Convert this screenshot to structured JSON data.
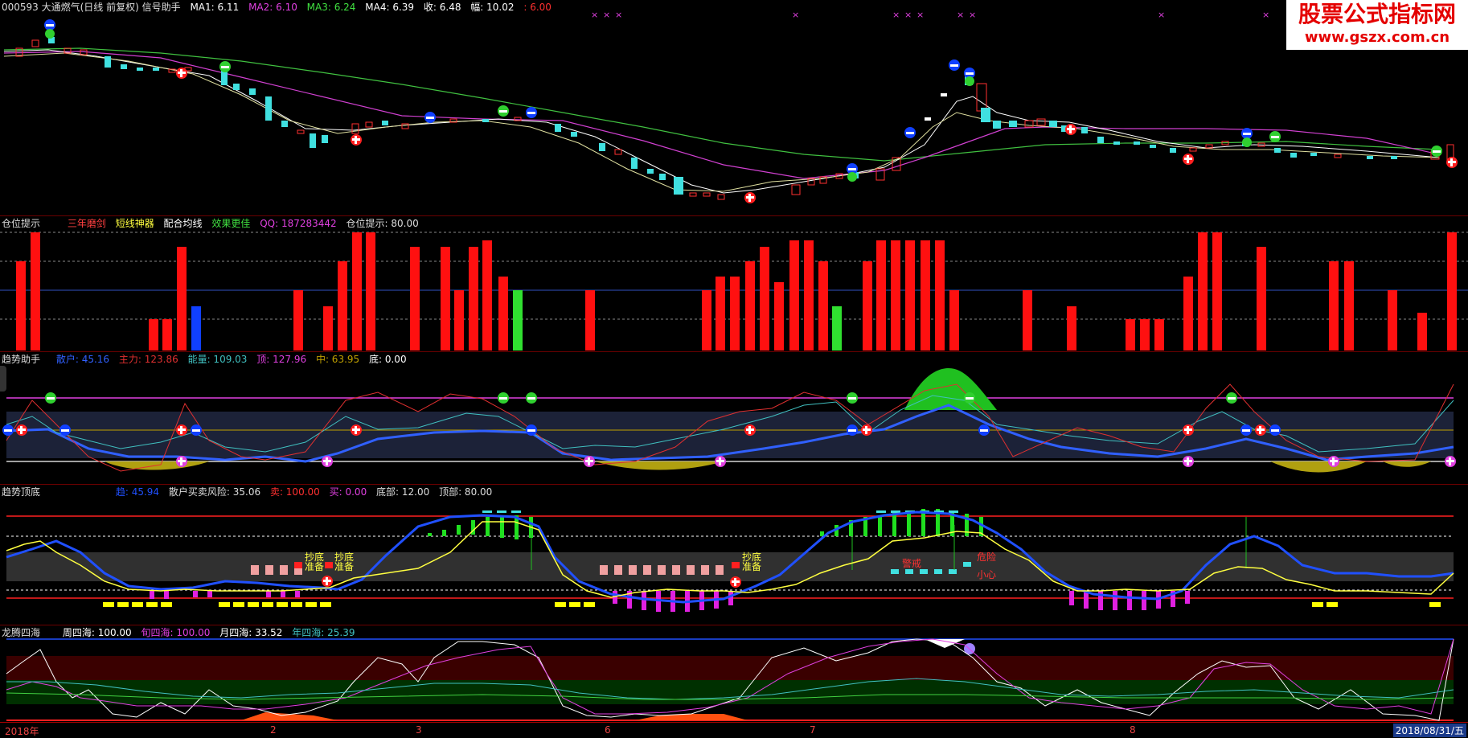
{
  "main": {
    "title": "000593 大通燃气(日线 前复权) 信号助手",
    "ma1_label": "MA1: 6.11",
    "ma2_label": "MA2: 6.10",
    "ma3_label": "MA3: 6.24",
    "ma4_label": "MA4: 6.39",
    "close_label": "收: 6.48",
    "range_label": "幅: 10.02",
    "extra_label": ": 6.00",
    "colors": {
      "ma1": "#ffffff",
      "ma2": "#e040e0",
      "ma3": "#40e040",
      "ma4": "#ffffff",
      "up": "#ff3030",
      "down": "#40e0e0"
    }
  },
  "logo": {
    "line1": "股票公式指标网",
    "line2": "www.gszx.com.cn"
  },
  "position_panel": {
    "title": "仓位提示",
    "tag1": "三年磨剑",
    "tag2": "短线神器",
    "tag3": "配合均线",
    "tag4": "效果更佳",
    "qq": "QQ: 187283442",
    "value_label": "仓位提示: 80.00"
  },
  "trend_panel": {
    "title": "趋势助手",
    "retail_label": "散户: 45.16",
    "main_label": "主力: 123.86",
    "energy_label": "能量: 109.03",
    "top_label": "顶: 127.96",
    "mid_label": "中: 63.95",
    "bottom_label": "底: 0.00"
  },
  "topbottom_panel": {
    "title": "趋势顶底",
    "trend_label": "趋: 45.94",
    "risk_label": "散户买卖风险: 35.06",
    "sell_label": "卖: 100.00",
    "buy_label": "买: 0.00",
    "floor_label": "底部: 12.00",
    "ceil_label": "顶部: 80.00",
    "annotations": {
      "bottom_ready": "抄底准备",
      "warning": "警戒",
      "danger": "危险",
      "careful": "小心"
    }
  },
  "dragon_panel": {
    "title": "龙腾四海",
    "week_label": "周四海: 100.00",
    "xun_label": "旬四海: 100.00",
    "month_label": "月四海: 33.52",
    "year_label": "年四海: 25.39"
  },
  "xaxis": {
    "labels": [
      "2018年",
      "2",
      "3",
      "6",
      "7",
      "8"
    ],
    "date": "2018/08/31/五"
  }
}
